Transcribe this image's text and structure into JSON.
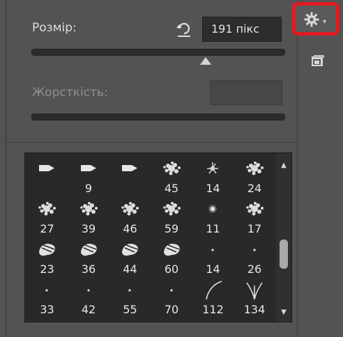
{
  "brush_panel": {
    "size_label": "Розмір:",
    "size_value": "191 пікс",
    "size_slider_fraction": 0.69,
    "hardness_label": "Жорсткість:",
    "hardness_value": "",
    "reset_icon": "reset-arrow-icon",
    "settings_icon": "gear-icon",
    "new_preset_icon": "new-preset-icon"
  },
  "brushes": [
    {
      "size": "",
      "kind": "bullet"
    },
    {
      "size": "9",
      "kind": "bullet"
    },
    {
      "size": "",
      "kind": "bullet"
    },
    {
      "size": "45",
      "kind": "splatter"
    },
    {
      "size": "14",
      "kind": "star"
    },
    {
      "size": "24",
      "kind": "splatter"
    },
    {
      "size": "27",
      "kind": "splatter"
    },
    {
      "size": "39",
      "kind": "splatter"
    },
    {
      "size": "46",
      "kind": "splatter"
    },
    {
      "size": "59",
      "kind": "splatter"
    },
    {
      "size": "11",
      "kind": "dot-soft"
    },
    {
      "size": "17",
      "kind": "splatter"
    },
    {
      "size": "23",
      "kind": "blot"
    },
    {
      "size": "36",
      "kind": "blot"
    },
    {
      "size": "44",
      "kind": "blot"
    },
    {
      "size": "60",
      "kind": "blot"
    },
    {
      "size": "14",
      "kind": "dot-small"
    },
    {
      "size": "26",
      "kind": "dot-small"
    },
    {
      "size": "33",
      "kind": "dot-small"
    },
    {
      "size": "42",
      "kind": "dot-small"
    },
    {
      "size": "55",
      "kind": "dot-small"
    },
    {
      "size": "70",
      "kind": "dot-small"
    },
    {
      "size": "112",
      "kind": "curve"
    },
    {
      "size": "134",
      "kind": "grass"
    }
  ],
  "scrollbar": {
    "up_icon": "scroll-up-arrow-icon",
    "down_icon": "scroll-down-arrow-icon"
  }
}
